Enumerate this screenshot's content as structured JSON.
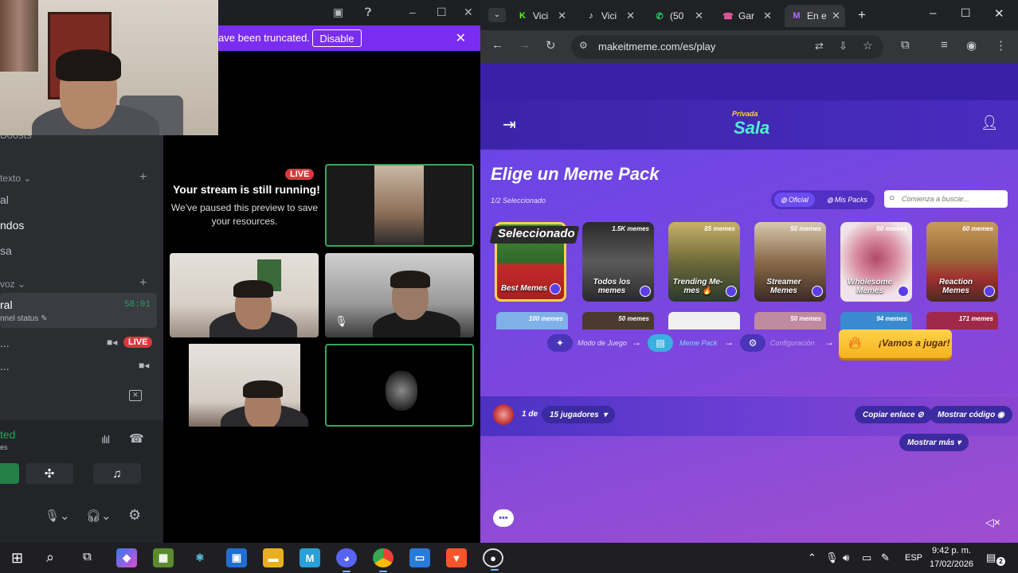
{
  "discord": {
    "banner": {
      "text": "ave been truncated.",
      "disable_label": "Disable"
    },
    "sidebar": {
      "boosts_label": "Boosts",
      "text_category": "texto",
      "channels": [
        "al",
        "ndos",
        "sa"
      ],
      "voice_category": "voz",
      "voice_channel": {
        "name": "ral",
        "timer": "58:01",
        "status": "nnel status"
      },
      "members": [
        {
          "name": "...",
          "live": "LIVE"
        },
        {
          "name": "..."
        }
      ],
      "connection": {
        "status": "ted",
        "sub": "es"
      }
    },
    "stream": {
      "live_badge": "LIVE",
      "title": "Your stream is still running!",
      "body": "We've paused this preview to save your resources."
    }
  },
  "browser": {
    "tabs": [
      {
        "icon": "kick-icon",
        "icon_glyph": "K",
        "color": "#53fc18",
        "label": "Vici"
      },
      {
        "icon": "tiktok-icon",
        "icon_glyph": "♪",
        "color": "#ffffff",
        "label": "Vici"
      },
      {
        "icon": "whatsapp-icon",
        "icon_glyph": "✆",
        "color": "#25d366",
        "label": "(50"
      },
      {
        "icon": "phone-icon",
        "icon_glyph": "☎",
        "color": "#e0569a",
        "label": "Gar"
      },
      {
        "icon": "makeitmeme-icon",
        "icon_glyph": "M",
        "color": "#b36bff",
        "label": "En e"
      }
    ],
    "url": "makeitmeme.com/es/play",
    "page": {
      "room_sub": "Privada",
      "room_title": "Sala",
      "pick_title": "Elige un Meme Pack",
      "selected": "1/2 Seleccionado",
      "filters": [
        "Oficial",
        "Mis Packs"
      ],
      "search_placeholder": "Comienza a buscar...",
      "selected_ribbon": "Seleccionado",
      "packs": [
        {
          "name": "Best Memes",
          "count": "",
          "color": "#2e7a30"
        },
        {
          "name": "Todos los memes",
          "count": "1.5K memes",
          "color": "#3a3a3a"
        },
        {
          "name": "Trending Me-mes 🔥",
          "count": "85 memes",
          "color": "#6e6a3a"
        },
        {
          "name": "Streamer Memes",
          "count": "50 memes",
          "color": "#8a6a4a"
        },
        {
          "name": "Wholesome Memes",
          "count": "50 memes",
          "color": "#d8c8cc"
        },
        {
          "name": "Reaction Memes",
          "count": "60 memes",
          "color": "#9a6a3a"
        }
      ],
      "packs_row2": [
        {
          "count": "100 memes",
          "color": "#7fb0e8"
        },
        {
          "count": "50 memes",
          "color": "#4a3a30"
        },
        {
          "count": "",
          "color": "#f0f0f0"
        },
        {
          "count": "50 memes",
          "color": "#c08aa0"
        },
        {
          "count": "94 memes",
          "color": "#3a8ad0"
        },
        {
          "count": "171 memes",
          "color": "#a0284a"
        }
      ],
      "steps": [
        "Modo de Juego",
        "Meme Pack",
        "Configuración"
      ],
      "play_label": "¡Vamos a jugar!",
      "players": {
        "count_label": "1 de",
        "max": "15 jugadores"
      },
      "copy_link": "Copiar enlace",
      "show_code": "Mostrar código",
      "show_more": "Mostrar más"
    }
  },
  "taskbar": {
    "language": "ESP",
    "time": "9:42 p. m.",
    "date": "17/02/2026",
    "notifications": "2"
  }
}
